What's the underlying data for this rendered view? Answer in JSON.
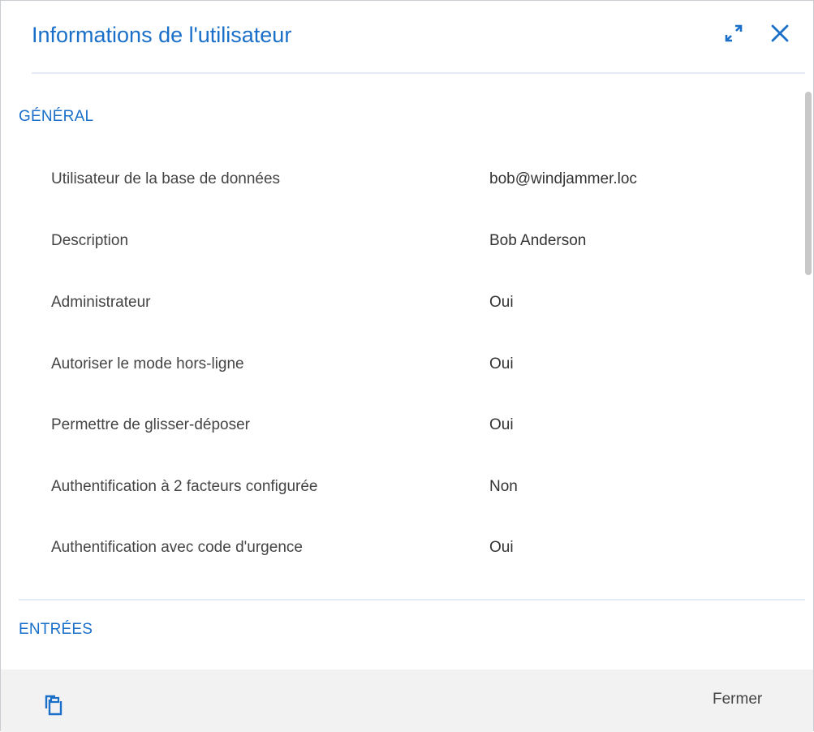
{
  "dialog": {
    "title": "Informations de l'utilisateur",
    "expand_icon": "expand-icon",
    "close_icon": "close-icon",
    "accent_color": "#1a6fc9"
  },
  "general": {
    "title": "GÉNÉRAL",
    "rows": [
      {
        "label": "Utilisateur de la base de données",
        "value": "bob@windjammer.loc"
      },
      {
        "label": "Description",
        "value": "Bob Anderson"
      },
      {
        "label": "Administrateur",
        "value": "Oui"
      },
      {
        "label": "Autoriser le mode hors-ligne",
        "value": "Oui"
      },
      {
        "label": "Permettre de glisser-déposer",
        "value": "Oui"
      },
      {
        "label": "Authentification à 2 facteurs configurée",
        "value": "Non"
      },
      {
        "label": "Authentification avec code d'urgence",
        "value": "Oui"
      }
    ]
  },
  "entries": {
    "title": "ENTRÉES"
  },
  "footer": {
    "copy_icon": "copy-icon",
    "close_label": "Fermer"
  }
}
